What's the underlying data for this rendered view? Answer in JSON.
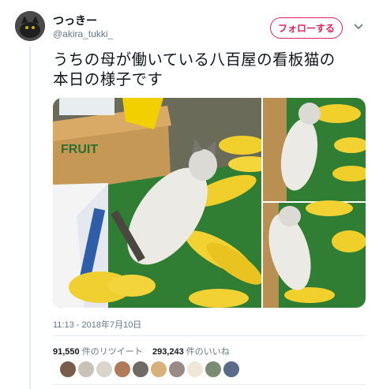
{
  "user": {
    "display_name": "つっきー",
    "handle": "@akira_tukki_"
  },
  "follow_button": {
    "label": "フォローする"
  },
  "more_menu": {
    "icon": "chevron-down-icon"
  },
  "tweet": {
    "line1": "うちの母が働いている八百屋の看板猫の",
    "line2": "本日の様子です"
  },
  "timestamp": "11:13 - 2018年7月10日",
  "stats": {
    "retweet_count": "91,550",
    "retweet_label": "件のリツイート",
    "like_count": "293,243",
    "like_label": "件のいいね"
  },
  "likers": [
    "avatar-1",
    "avatar-2",
    "avatar-3",
    "avatar-4",
    "avatar-5",
    "avatar-6",
    "avatar-7",
    "avatar-8",
    "avatar-9",
    "avatar-10"
  ],
  "colors": {
    "accent": "#e0245e",
    "text": "#14171a",
    "muted": "#657786",
    "border": "#e6ecf0"
  }
}
